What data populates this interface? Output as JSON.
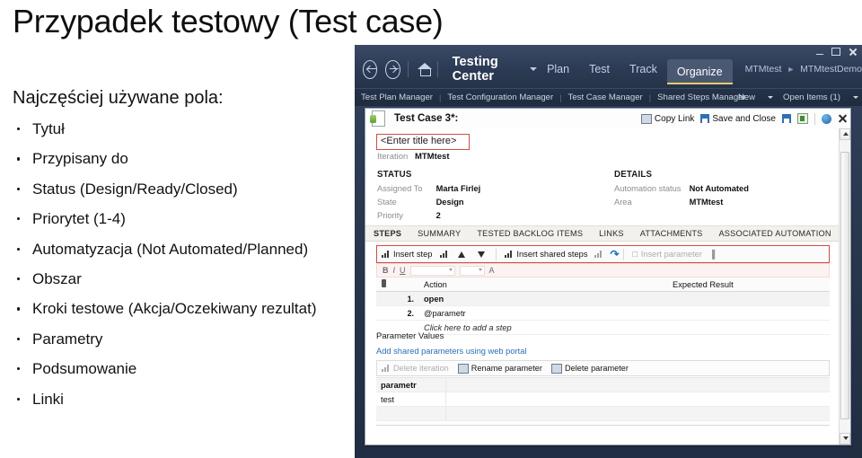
{
  "slide": {
    "title": "Przypadek testowy (Test case)",
    "lead": "Najczęściej używane pola:",
    "bullets": [
      "Tytuł",
      "Przypisany do",
      "Status (Design/Ready/Closed)",
      "Priorytet (1-4)",
      "Automatyzacja (Not Automated/Planned)",
      "Obszar",
      "Kroki testowe (Akcja/Oczekiwany rezultat)",
      "Parametry",
      "Podsumowanie",
      "Linki"
    ]
  },
  "app": {
    "brand": "Testing Center",
    "nav_tabs": [
      {
        "label": "Plan",
        "active": false
      },
      {
        "label": "Test",
        "active": false
      },
      {
        "label": "Track",
        "active": false
      },
      {
        "label": "Organize",
        "active": true
      }
    ],
    "breadcrumb": {
      "project": "MTMtest",
      "separator": "►",
      "plan": "MTMtestDemo"
    },
    "managers": [
      "Test Plan Manager",
      "Test Configuration Manager",
      "Test Case Manager",
      "Shared Steps Manager"
    ],
    "new_label": "New",
    "open_items_label": "Open Items (1)",
    "window_buttons": [
      "minimize",
      "maximize",
      "close"
    ],
    "accent_tab_underline": "#e9c96b",
    "chrome_color": "#2c3b55"
  },
  "testcase": {
    "header_title": "Test Case 3*:",
    "header_actions": [
      "Copy Link",
      "Save and Close"
    ],
    "title_placeholder": "<Enter title here>",
    "title_box_border": "#d04b44",
    "iteration": {
      "label": "Iteration",
      "value": "MTMtest"
    },
    "status": {
      "heading": "STATUS",
      "fields": [
        {
          "label": "Assigned To",
          "value": "Marta Firlej"
        },
        {
          "label": "State",
          "value": "Design"
        },
        {
          "label": "Priority",
          "value": "2"
        }
      ]
    },
    "details": {
      "heading": "DETAILS",
      "fields": [
        {
          "label": "Automation status",
          "value": "Not Automated"
        },
        {
          "label": "Area",
          "value": "MTMtest"
        }
      ]
    },
    "tabs": [
      {
        "label": "STEPS",
        "selected": true
      },
      {
        "label": "SUMMARY",
        "selected": false
      },
      {
        "label": "TESTED BACKLOG ITEMS",
        "selected": false
      },
      {
        "label": "LINKS",
        "selected": false
      },
      {
        "label": "ATTACHMENTS",
        "selected": false
      },
      {
        "label": "ASSOCIATED AUTOMATION",
        "selected": false
      }
    ],
    "step_toolbar": {
      "insert_step": "Insert step",
      "insert_shared_steps": "Insert shared steps",
      "insert_parameter": "Insert parameter",
      "border_color": "#d04b44"
    },
    "format_bar": {
      "bold": "B",
      "italic": "I",
      "underline": "U",
      "font_color": "A"
    },
    "steps_grid": {
      "columns": [
        "Action",
        "Expected Result"
      ],
      "rows": [
        {
          "num": "1.",
          "action": "open",
          "expected": ""
        },
        {
          "num": "2.",
          "action": "@parametr",
          "expected": ""
        }
      ],
      "add_row_hint": "Click here to add a step"
    },
    "parameters": {
      "heading": "Parameter Values",
      "link": "Add shared parameters using web portal",
      "toolbar": [
        "Delete iteration",
        "Rename parameter",
        "Delete parameter"
      ],
      "rows": [
        {
          "name": "parametr",
          "value": ""
        },
        {
          "name": "test",
          "value": ""
        },
        {
          "name": "",
          "value": ""
        }
      ]
    }
  }
}
